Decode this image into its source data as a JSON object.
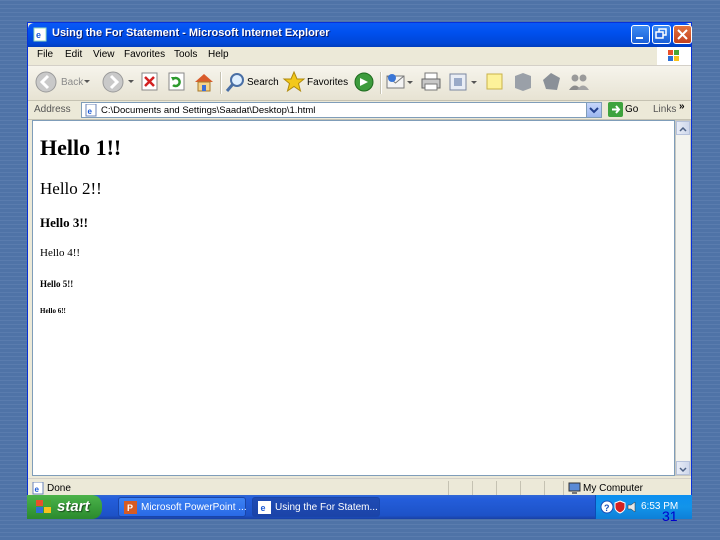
{
  "window": {
    "title": "Using the For Statement - Microsoft Internet Explorer"
  },
  "menu": {
    "items": [
      "File",
      "Edit",
      "View",
      "Favorites",
      "Tools",
      "Help"
    ]
  },
  "toolbar": {
    "back_label": "Back",
    "search_label": "Search",
    "favorites_label": "Favorites"
  },
  "address": {
    "label": "Address",
    "value": "C:\\Documents and Settings\\Saadat\\Desktop\\1.html",
    "go_label": "Go",
    "links_label": "Links",
    "more": "»"
  },
  "content": {
    "headings": [
      "Hello 1!!",
      "Hello 2!!",
      "Hello 3!!",
      "Hello 4!!",
      "Hello 5!!",
      "Hello 6!!"
    ]
  },
  "status": {
    "text": "Done",
    "zone": "My Computer"
  },
  "taskbar": {
    "start_label": "start",
    "tasks": [
      "Microsoft PowerPoint ...",
      "Using the For Statem..."
    ],
    "clock": "6:53 PM"
  },
  "slide": {
    "page_number": "31"
  }
}
